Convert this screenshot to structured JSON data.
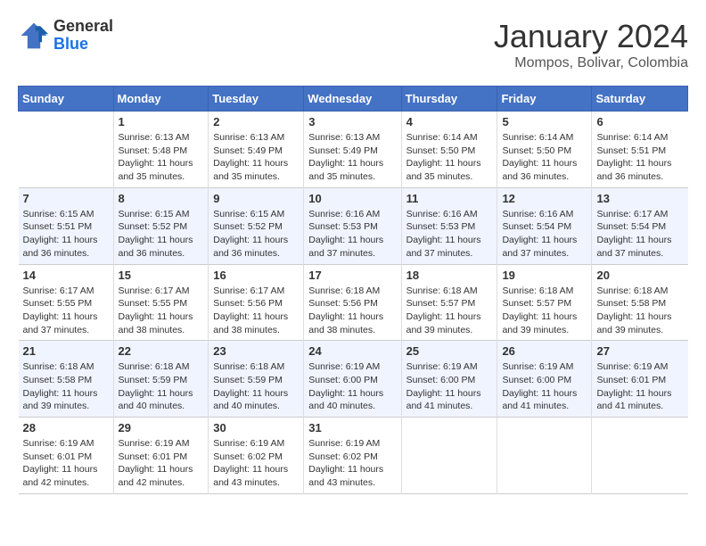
{
  "logo": {
    "general": "General",
    "blue": "Blue"
  },
  "header": {
    "month": "January 2024",
    "location": "Mompos, Bolivar, Colombia"
  },
  "weekdays": [
    "Sunday",
    "Monday",
    "Tuesday",
    "Wednesday",
    "Thursday",
    "Friday",
    "Saturday"
  ],
  "weeks": [
    [
      {
        "day": "",
        "sunrise": "",
        "sunset": "",
        "daylight": ""
      },
      {
        "day": "1",
        "sunrise": "6:13 AM",
        "sunset": "5:48 PM",
        "daylight": "11 hours and 35 minutes."
      },
      {
        "day": "2",
        "sunrise": "6:13 AM",
        "sunset": "5:49 PM",
        "daylight": "11 hours and 35 minutes."
      },
      {
        "day": "3",
        "sunrise": "6:13 AM",
        "sunset": "5:49 PM",
        "daylight": "11 hours and 35 minutes."
      },
      {
        "day": "4",
        "sunrise": "6:14 AM",
        "sunset": "5:50 PM",
        "daylight": "11 hours and 35 minutes."
      },
      {
        "day": "5",
        "sunrise": "6:14 AM",
        "sunset": "5:50 PM",
        "daylight": "11 hours and 36 minutes."
      },
      {
        "day": "6",
        "sunrise": "6:14 AM",
        "sunset": "5:51 PM",
        "daylight": "11 hours and 36 minutes."
      }
    ],
    [
      {
        "day": "7",
        "sunrise": "6:15 AM",
        "sunset": "5:51 PM",
        "daylight": "11 hours and 36 minutes."
      },
      {
        "day": "8",
        "sunrise": "6:15 AM",
        "sunset": "5:52 PM",
        "daylight": "11 hours and 36 minutes."
      },
      {
        "day": "9",
        "sunrise": "6:15 AM",
        "sunset": "5:52 PM",
        "daylight": "11 hours and 36 minutes."
      },
      {
        "day": "10",
        "sunrise": "6:16 AM",
        "sunset": "5:53 PM",
        "daylight": "11 hours and 37 minutes."
      },
      {
        "day": "11",
        "sunrise": "6:16 AM",
        "sunset": "5:53 PM",
        "daylight": "11 hours and 37 minutes."
      },
      {
        "day": "12",
        "sunrise": "6:16 AM",
        "sunset": "5:54 PM",
        "daylight": "11 hours and 37 minutes."
      },
      {
        "day": "13",
        "sunrise": "6:17 AM",
        "sunset": "5:54 PM",
        "daylight": "11 hours and 37 minutes."
      }
    ],
    [
      {
        "day": "14",
        "sunrise": "6:17 AM",
        "sunset": "5:55 PM",
        "daylight": "11 hours and 37 minutes."
      },
      {
        "day": "15",
        "sunrise": "6:17 AM",
        "sunset": "5:55 PM",
        "daylight": "11 hours and 38 minutes."
      },
      {
        "day": "16",
        "sunrise": "6:17 AM",
        "sunset": "5:56 PM",
        "daylight": "11 hours and 38 minutes."
      },
      {
        "day": "17",
        "sunrise": "6:18 AM",
        "sunset": "5:56 PM",
        "daylight": "11 hours and 38 minutes."
      },
      {
        "day": "18",
        "sunrise": "6:18 AM",
        "sunset": "5:57 PM",
        "daylight": "11 hours and 39 minutes."
      },
      {
        "day": "19",
        "sunrise": "6:18 AM",
        "sunset": "5:57 PM",
        "daylight": "11 hours and 39 minutes."
      },
      {
        "day": "20",
        "sunrise": "6:18 AM",
        "sunset": "5:58 PM",
        "daylight": "11 hours and 39 minutes."
      }
    ],
    [
      {
        "day": "21",
        "sunrise": "6:18 AM",
        "sunset": "5:58 PM",
        "daylight": "11 hours and 39 minutes."
      },
      {
        "day": "22",
        "sunrise": "6:18 AM",
        "sunset": "5:59 PM",
        "daylight": "11 hours and 40 minutes."
      },
      {
        "day": "23",
        "sunrise": "6:18 AM",
        "sunset": "5:59 PM",
        "daylight": "11 hours and 40 minutes."
      },
      {
        "day": "24",
        "sunrise": "6:19 AM",
        "sunset": "6:00 PM",
        "daylight": "11 hours and 40 minutes."
      },
      {
        "day": "25",
        "sunrise": "6:19 AM",
        "sunset": "6:00 PM",
        "daylight": "11 hours and 41 minutes."
      },
      {
        "day": "26",
        "sunrise": "6:19 AM",
        "sunset": "6:00 PM",
        "daylight": "11 hours and 41 minutes."
      },
      {
        "day": "27",
        "sunrise": "6:19 AM",
        "sunset": "6:01 PM",
        "daylight": "11 hours and 41 minutes."
      }
    ],
    [
      {
        "day": "28",
        "sunrise": "6:19 AM",
        "sunset": "6:01 PM",
        "daylight": "11 hours and 42 minutes."
      },
      {
        "day": "29",
        "sunrise": "6:19 AM",
        "sunset": "6:01 PM",
        "daylight": "11 hours and 42 minutes."
      },
      {
        "day": "30",
        "sunrise": "6:19 AM",
        "sunset": "6:02 PM",
        "daylight": "11 hours and 43 minutes."
      },
      {
        "day": "31",
        "sunrise": "6:19 AM",
        "sunset": "6:02 PM",
        "daylight": "11 hours and 43 minutes."
      },
      {
        "day": "",
        "sunrise": "",
        "sunset": "",
        "daylight": ""
      },
      {
        "day": "",
        "sunrise": "",
        "sunset": "",
        "daylight": ""
      },
      {
        "day": "",
        "sunrise": "",
        "sunset": "",
        "daylight": ""
      }
    ]
  ],
  "labels": {
    "sunrise_prefix": "Sunrise: ",
    "sunset_prefix": "Sunset: ",
    "daylight_prefix": "Daylight: "
  }
}
